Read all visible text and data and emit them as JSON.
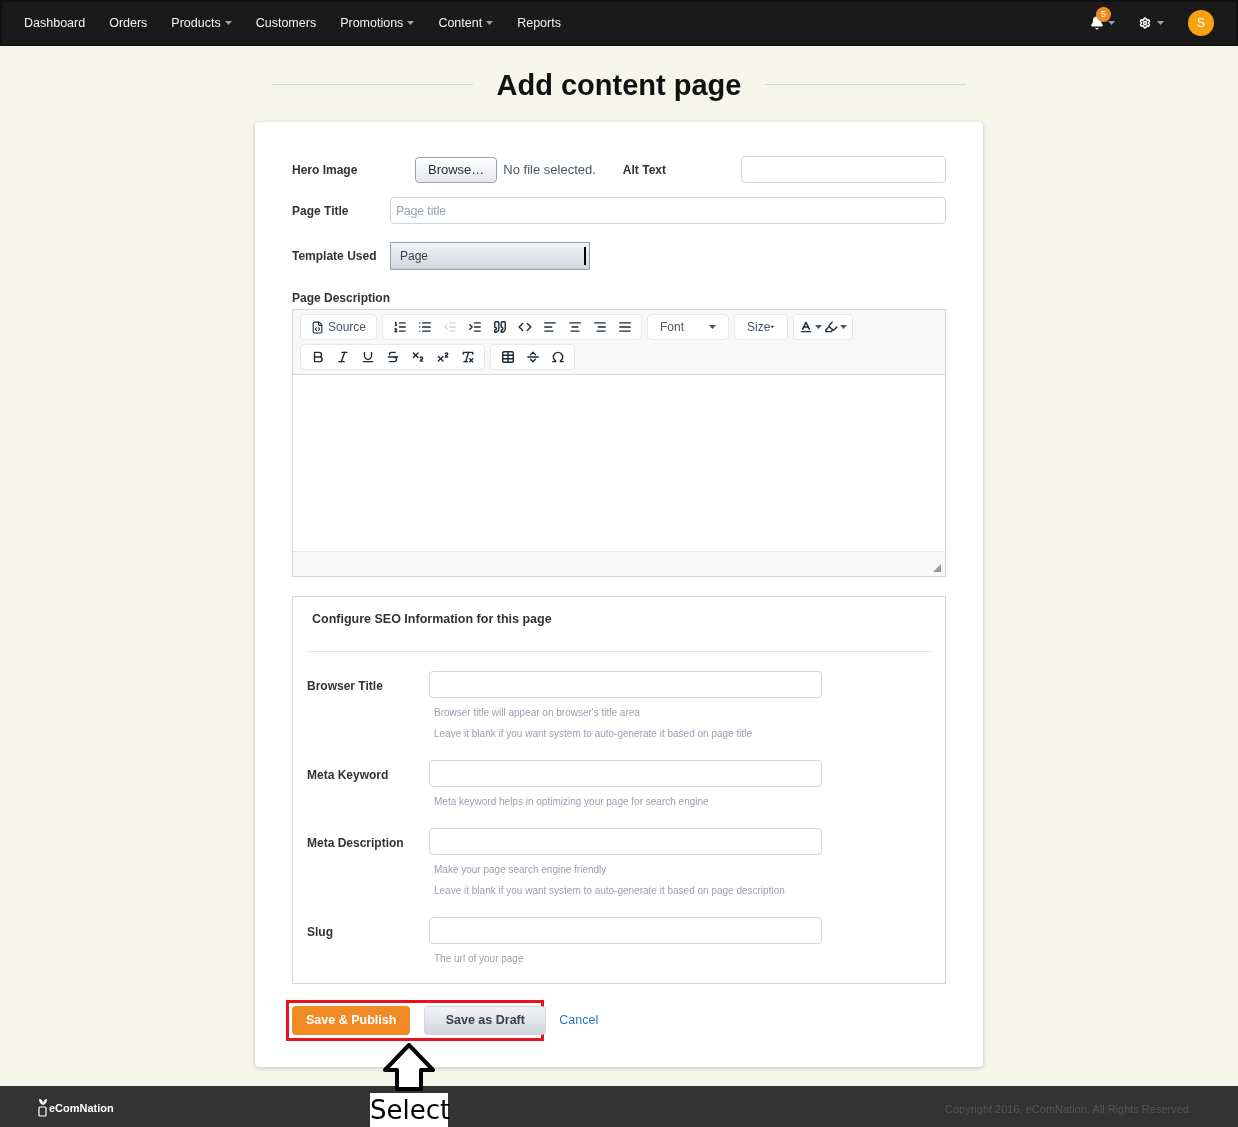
{
  "nav": {
    "items": [
      {
        "label": "Dashboard",
        "dropdown": false
      },
      {
        "label": "Orders",
        "dropdown": false
      },
      {
        "label": "Products",
        "dropdown": true
      },
      {
        "label": "Customers",
        "dropdown": false
      },
      {
        "label": "Promotions",
        "dropdown": true
      },
      {
        "label": "Content",
        "dropdown": true
      },
      {
        "label": "Reports",
        "dropdown": false
      }
    ],
    "notification_count": "5",
    "avatar": "S"
  },
  "title": "Add content page",
  "form": {
    "hero_label": "Hero Image",
    "browse": "Browse…",
    "no_file": "No file selected.",
    "alt_label": "Alt Text",
    "page_title_label": "Page Title",
    "page_title_placeholder": "Page title",
    "template_label": "Template Used",
    "template_value": "Page",
    "description_label": "Page Description"
  },
  "toolbar": [
    [
      {
        "kind": "source",
        "label": "Source",
        "disabled": false
      }
    ],
    [
      {
        "kind": "ordered-list",
        "disabled": false
      },
      {
        "kind": "bullet-list",
        "disabled": false
      },
      {
        "kind": "outdent",
        "disabled": true
      },
      {
        "kind": "indent",
        "disabled": false
      },
      {
        "kind": "quote",
        "disabled": false
      },
      {
        "kind": "div",
        "disabled": false
      },
      {
        "kind": "align-left",
        "disabled": false
      },
      {
        "kind": "align-center",
        "disabled": false
      },
      {
        "kind": "align-right",
        "disabled": false
      },
      {
        "kind": "justify",
        "disabled": false
      }
    ],
    [
      {
        "kind": "combo",
        "label": "Font",
        "disabled": false
      }
    ],
    [
      {
        "kind": "combo",
        "label": "Size",
        "disabled": false
      }
    ],
    [
      {
        "kind": "text-color",
        "disabled": false
      },
      {
        "kind": "bg-color",
        "disabled": false
      }
    ],
    [
      {
        "kind": "bold",
        "disabled": false
      },
      {
        "kind": "italic",
        "disabled": false
      },
      {
        "kind": "underline",
        "disabled": false
      },
      {
        "kind": "strike",
        "disabled": false
      },
      {
        "kind": "subscript",
        "disabled": false
      },
      {
        "kind": "superscript",
        "disabled": false
      },
      {
        "kind": "clear-format",
        "disabled": false
      }
    ],
    [
      {
        "kind": "table",
        "disabled": false
      },
      {
        "kind": "rule",
        "disabled": false
      },
      {
        "kind": "omega",
        "disabled": false
      }
    ]
  ],
  "seo": {
    "heading": "Configure SEO Information for this page",
    "fields": [
      {
        "label": "Browser Title",
        "hints": [
          "Browser title will appear on browser's title area",
          "Leave it blank if you want system to auto-generate it based on page title"
        ]
      },
      {
        "label": "Meta Keyword",
        "hints": [
          "Meta keyword helps in optimizing your page for search engine"
        ]
      },
      {
        "label": "Meta Description",
        "hints": [
          "Make your page search engine friendly",
          "Leave it blank if you want system to auto-generate it based on page description"
        ]
      },
      {
        "label": "Slug",
        "hints": [
          "The url of your page"
        ]
      }
    ]
  },
  "buttons": {
    "publish": "Save & Publish",
    "draft": "Save as Draft",
    "cancel": "Cancel"
  },
  "annotation": "Select",
  "footer": {
    "brand": "eComNation",
    "copyright": "Copyright 2016, eComNation. All Rights Reserved."
  }
}
